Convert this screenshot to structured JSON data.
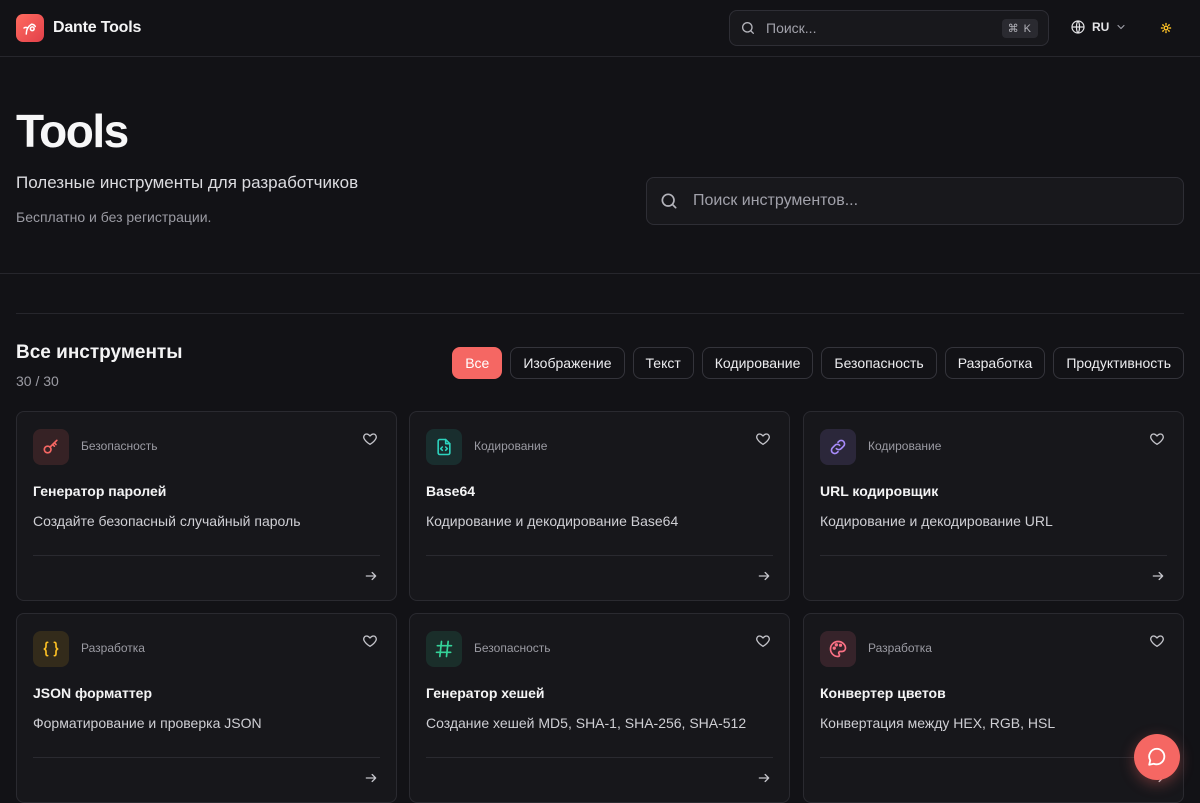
{
  "brand": {
    "name": "Dante Tools",
    "logo_icon": "dante-logo-icon",
    "accent": "#f56763"
  },
  "header": {
    "search_placeholder": "Поиск...",
    "search_shortcut": "⌘ K",
    "language": "RU",
    "theme_icon": "sun-icon"
  },
  "hero": {
    "title": "Tools",
    "subtitle": "Полезные инструменты для разработчиков",
    "note": "Бесплатно и без регистрации.",
    "search_placeholder": "Поиск инструментов..."
  },
  "tools_section": {
    "title": "Все инструменты",
    "count": "30 / 30",
    "filters": [
      "Все",
      "Изображение",
      "Текст",
      "Кодирование",
      "Безопасность",
      "Разработка",
      "Продуктивность"
    ],
    "active_filter": "Все"
  },
  "cards": [
    {
      "category": "Безопасность",
      "name": "Генератор паролей",
      "description": "Создайте безопасный случайный пароль",
      "icon": "key-icon",
      "color": "#f56763"
    },
    {
      "category": "Кодирование",
      "name": "Base64",
      "description": "Кодирование и декодирование Base64",
      "icon": "file-code-icon",
      "color": "#2dd4bf"
    },
    {
      "category": "Кодирование",
      "name": "URL кодировщик",
      "description": "Кодирование и декодирование URL",
      "icon": "link-icon",
      "color": "#a78bfa"
    },
    {
      "category": "Разработка",
      "name": "JSON форматтер",
      "description": "Форматирование и проверка JSON",
      "icon": "braces-icon",
      "color": "#fbbf24"
    },
    {
      "category": "Безопасность",
      "name": "Генератор хешей",
      "description": "Создание хешей MD5, SHA-1, SHA-256, SHA-512",
      "icon": "hash-icon",
      "color": "#34d399"
    },
    {
      "category": "Разработка",
      "name": "Конвертер цветов",
      "description": "Конвертация между HEX, RGB, HSL",
      "icon": "palette-icon",
      "color": "#fb7185"
    }
  ]
}
